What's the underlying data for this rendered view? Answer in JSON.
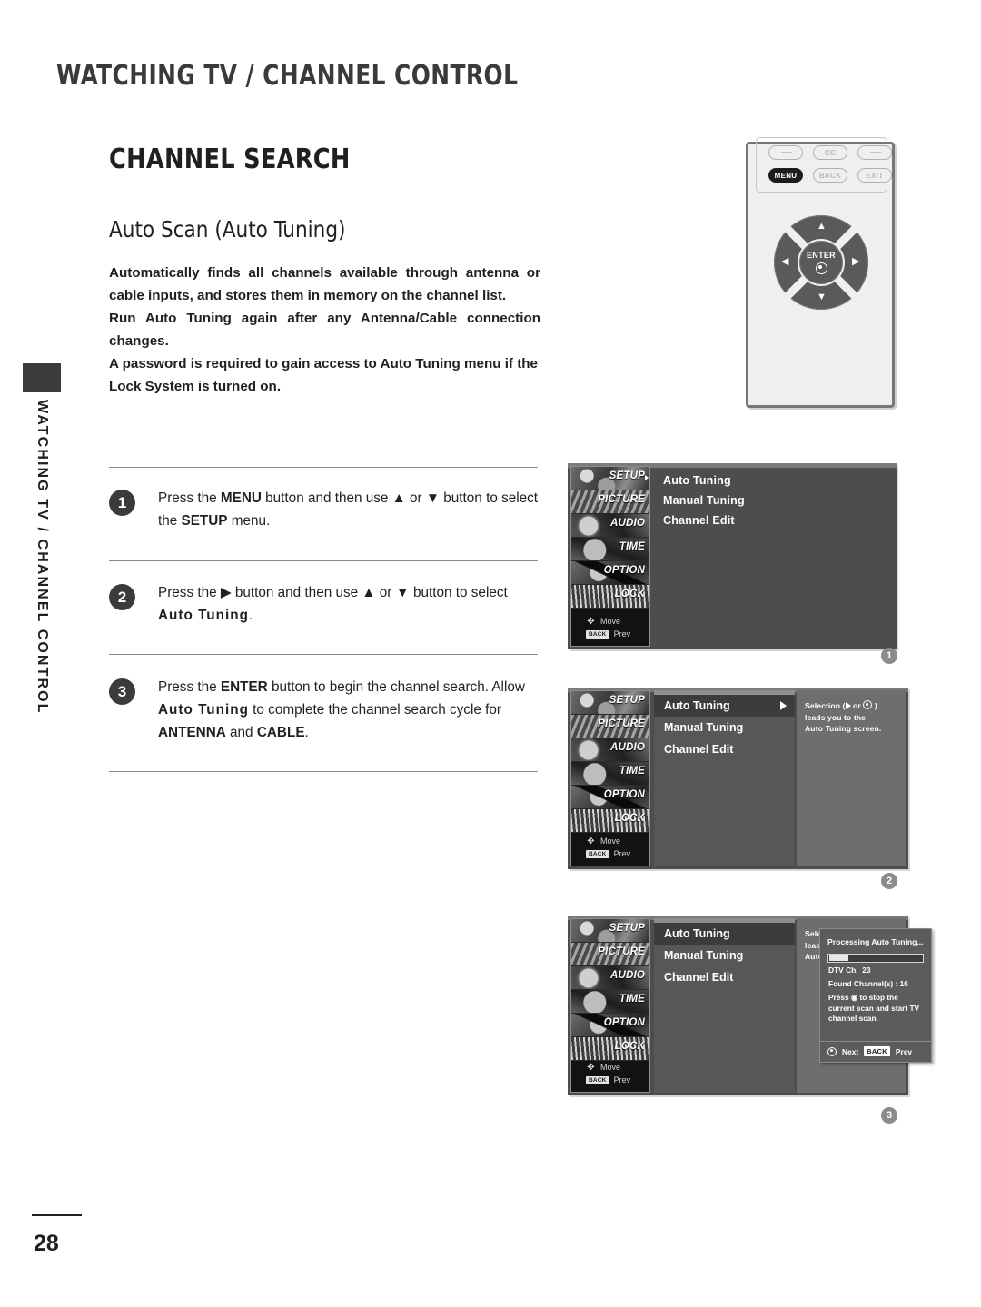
{
  "page": {
    "running_head": "WATCHING TV / CHANNEL CONTROL",
    "side_tab": "WATCHING TV / CHANNEL CONTROL",
    "number": "28"
  },
  "section": {
    "title": "CHANNEL SEARCH",
    "subtitle": "Auto Scan (Auto Tuning)",
    "paragraphs": [
      "Automatically finds all channels available through antenna or cable inputs, and stores them in memory on the channel list.",
      "Run Auto Tuning again after any Antenna/Cable connection changes.",
      "A password is required to gain access to Auto Tuning menu if the Lock System is turned on."
    ]
  },
  "steps": [
    {
      "number": "1",
      "parts": [
        {
          "t": "Press the ",
          "b": false
        },
        {
          "t": "MENU",
          "b": true
        },
        {
          "t": " button and then use ▲ or ▼ button to select the ",
          "b": false
        },
        {
          "t": "SETUP",
          "b": true
        },
        {
          "t": " menu.",
          "b": false
        }
      ]
    },
    {
      "number": "2",
      "parts": [
        {
          "t": "Press the ▶ button and then use ▲ or ▼ button to select ",
          "b": false
        },
        {
          "t": "Auto Tuning",
          "b": true,
          "sp": true
        },
        {
          "t": ".",
          "b": false
        }
      ]
    },
    {
      "number": "3",
      "parts": [
        {
          "t": "Press the ",
          "b": false
        },
        {
          "t": "ENTER",
          "b": true
        },
        {
          "t": " button to begin the channel search. Allow ",
          "b": false
        },
        {
          "t": "Auto Tuning",
          "b": true,
          "sp": true
        },
        {
          "t": " to complete the channel search cycle for ",
          "b": false
        },
        {
          "t": "ANTENNA",
          "b": true
        },
        {
          "t": " and ",
          "b": false
        },
        {
          "t": "CABLE",
          "b": true
        },
        {
          "t": ".",
          "b": false
        }
      ]
    }
  ],
  "remote": {
    "buttons_row1": [
      "",
      "CC",
      ""
    ],
    "buttons_row2": [
      "MENU",
      "BACK",
      "EXIT"
    ],
    "highlighted": "MENU",
    "dpad": {
      "enter_label": "ENTER",
      "up": "▲",
      "down": "▼",
      "left": "◀",
      "right": "▶"
    }
  },
  "osd": {
    "sidebar": [
      {
        "label": "SETUP",
        "selected": true
      },
      {
        "label": "PICTURE",
        "selected": false
      },
      {
        "label": "AUDIO",
        "selected": false
      },
      {
        "label": "TIME",
        "selected": false
      },
      {
        "label": "OPTION",
        "selected": false
      },
      {
        "label": "LOCK",
        "selected": false
      }
    ],
    "footer": {
      "move_label": "Move",
      "prev_badge": "BACK",
      "prev_label": "Prev"
    },
    "menu_items": [
      "Auto Tuning",
      "Manual Tuning",
      "Channel Edit"
    ],
    "selected_item": "Auto Tuning",
    "help": {
      "line1_a": "Selection (",
      "line1_b": " or ",
      "line1_c": " )",
      "line2": "leads you to the",
      "line3": "Auto Tuning screen."
    },
    "dialog": {
      "title": "Processing Auto Tuning...",
      "progress_percent": 20,
      "channel_label": "DTV Ch.",
      "channel_value": "23",
      "found_label": "Found Channel(s) :",
      "found_value": "16",
      "note": "Press ◉ to stop the current scan and start TV channel  scan.",
      "footer_next": "Next",
      "footer_back_badge": "BACK",
      "footer_prev": "Prev"
    }
  },
  "step_markers": [
    "1",
    "2",
    "3"
  ],
  "colors": {
    "osd_bg": "#4d4d4d",
    "osd_sidebar_bg": "#121212",
    "osd_col_mid": "#575757",
    "osd_col_right": "#6e6e6e",
    "osd_selected_row": "#3c3c3c",
    "remote_body": "#efefef",
    "remote_border": "#77777a",
    "text": "#231f20"
  }
}
